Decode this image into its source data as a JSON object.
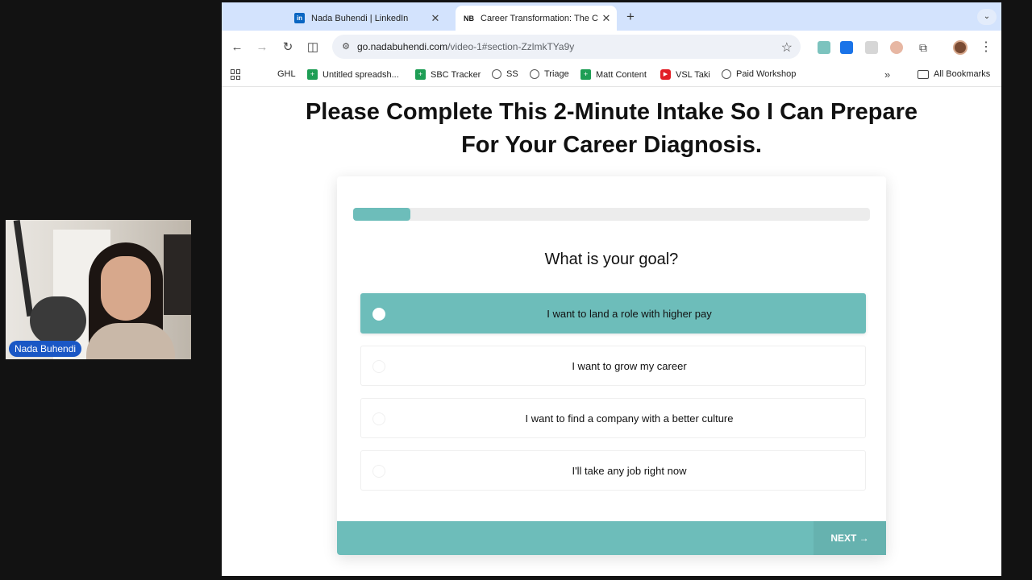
{
  "webcam": {
    "name_label": "Nada Buhendi"
  },
  "browser": {
    "tabs": [
      {
        "favicon": "in",
        "title": "Nada Buhendi | LinkedIn",
        "close": "✕"
      },
      {
        "favicon": "NB",
        "title": "Career Transformation: The C",
        "close": "✕"
      }
    ],
    "new_tab": "+",
    "tab_list": "⌄",
    "nav": {
      "back": "←",
      "forward": "→",
      "reload": "↻",
      "split": "◫"
    },
    "address": {
      "host": "go.nadabuhendi.com",
      "path": "/video-1#section-ZzlmkTYa9y"
    },
    "icons": {
      "site_info": "⚙",
      "star": "☆",
      "extensions": "⧉",
      "menu": "⋮"
    },
    "bookmarks": {
      "items": [
        {
          "label": "GHL",
          "icon": "none"
        },
        {
          "label": "Untitled spreadsh...",
          "icon": "sheets-icon"
        },
        {
          "label": "SBC Tracker",
          "icon": "sheets-icon"
        },
        {
          "label": "SS",
          "icon": "globe-icon"
        },
        {
          "label": "Triage",
          "icon": "globe-icon"
        },
        {
          "label": "Matt Content",
          "icon": "sheets-icon"
        },
        {
          "label": "VSL Taki",
          "icon": "youtube-icon"
        },
        {
          "label": "Paid Workshop",
          "icon": "globe-icon"
        }
      ],
      "more": "»",
      "all_bookmarks": "All Bookmarks"
    }
  },
  "page": {
    "headline": "Please Complete This 2-Minute Intake So I Can Prepare For Your Career Diagnosis.",
    "progress_fraction": 0.11,
    "question": "What is your goal?",
    "options": [
      {
        "label": "I want to land a role with higher pay",
        "selected": true
      },
      {
        "label": "I want to grow my career",
        "selected": false
      },
      {
        "label": "I want to find a company with a better culture",
        "selected": false
      },
      {
        "label": "I'll take any job right now",
        "selected": false
      }
    ],
    "next_label": "NEXT →"
  },
  "colors": {
    "accent": "#6dbdba",
    "tabstrip": "#d3e3fd",
    "name_badge": "#1a57c5"
  }
}
